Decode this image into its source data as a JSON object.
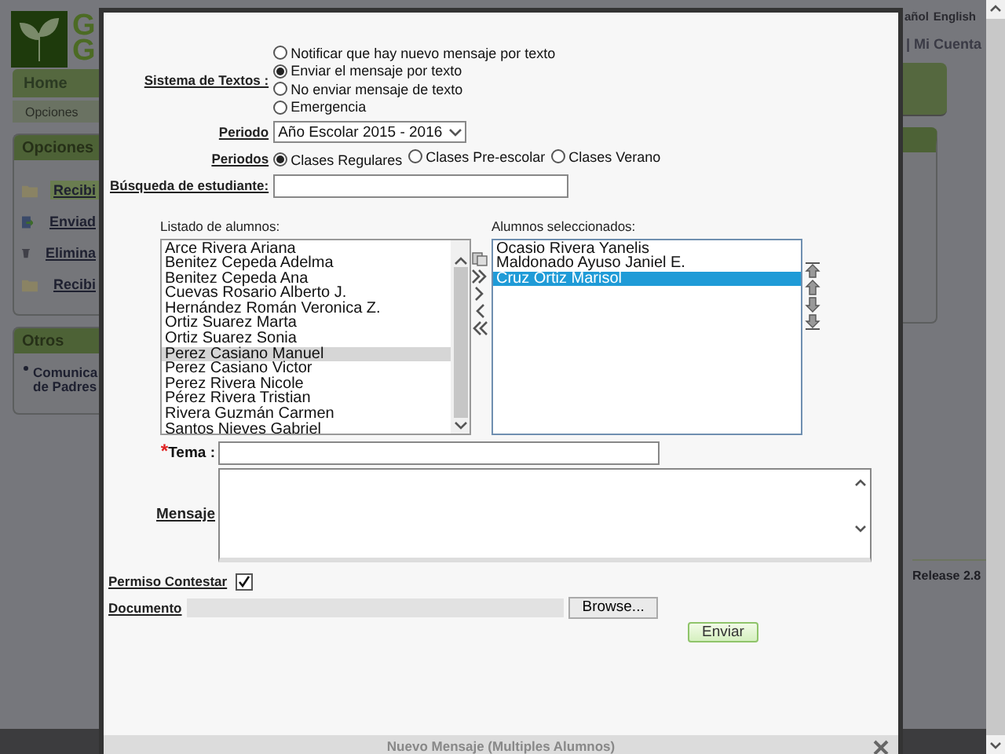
{
  "background_page": {
    "logo_letters": [
      "G",
      "G"
    ],
    "language_links": [
      "añol",
      "English"
    ],
    "account_link": "| Mi Cuenta",
    "nav_tab": "Home",
    "sub_nav": "Opciones",
    "options_panel": {
      "title": "Opciones",
      "items": [
        {
          "label": "Recibi",
          "kind": "folder",
          "selected": true
        },
        {
          "label": "Enviad",
          "kind": "send",
          "selected": false
        },
        {
          "label": "Elimina",
          "kind": "trash",
          "selected": false
        },
        {
          "label": "Recibi",
          "kind": "folder",
          "selected": false
        }
      ]
    },
    "others_panel": {
      "title": "Otros",
      "items": [
        {
          "lines": [
            "Comunica",
            "de Padres"
          ]
        }
      ]
    },
    "release": "Release 2.8"
  },
  "dialog": {
    "title": "Nuevo Mensaje (Multiples Alumnos)",
    "sms_system": {
      "label": "Sistema de Textos :",
      "options": [
        {
          "label": "Notificar que hay nuevo mensaje por texto",
          "selected": false
        },
        {
          "label": "Enviar el mensaje por texto",
          "selected": true
        },
        {
          "label": "No enviar mensaje de texto",
          "selected": false
        },
        {
          "label": "Emergencia",
          "selected": false
        }
      ]
    },
    "period": {
      "label": "Periodo",
      "value": "Año Escolar 2015 - 2016"
    },
    "periods": {
      "label": "Periodos",
      "options": [
        {
          "label": "Clases Regulares",
          "selected": true
        },
        {
          "label": "Clases Pre-escolar",
          "selected": false
        },
        {
          "label": "Clases Verano",
          "selected": false
        }
      ]
    },
    "search": {
      "label": "Búsqueda de estudiante:"
    },
    "available": {
      "label": "Listado de alumnos:",
      "focused": false,
      "items": [
        {
          "name": "Arce Rivera Ariana",
          "selected": false
        },
        {
          "name": "Benitez Cepeda Adelma",
          "selected": false
        },
        {
          "name": "Benitez Cepeda Ana",
          "selected": false
        },
        {
          "name": "Cuevas Rosario Alberto J.",
          "selected": false
        },
        {
          "name": "Hernández Román Veronica Z.",
          "selected": false
        },
        {
          "name": "Ortiz Suarez Marta",
          "selected": false
        },
        {
          "name": "Ortiz Suarez Sonia",
          "selected": false
        },
        {
          "name": "Perez Casiano Manuel",
          "selected": true
        },
        {
          "name": "Perez Casiano Victor",
          "selected": false
        },
        {
          "name": "Perez Rivera Nicole",
          "selected": false
        },
        {
          "name": "Pérez Rivera Tristian",
          "selected": false
        },
        {
          "name": "Rivera Guzmán Carmen",
          "selected": false
        },
        {
          "name": "Santos Nieves Gabriel",
          "selected": false
        }
      ]
    },
    "chosen": {
      "label": "Alumnos seleccionados:",
      "focused": true,
      "items": [
        {
          "name": "Ocasio Rivera Yanelis",
          "selected": false
        },
        {
          "name": "Maldonado Ayuso Janiel E.",
          "selected": false
        },
        {
          "name": "Cruz Ortiz Marisol",
          "selected": true
        }
      ]
    },
    "subject": {
      "label": "Tema :",
      "required_mark": "*"
    },
    "message": {
      "label": "Mensaje"
    },
    "allow_reply": {
      "label": "Permiso Contestar",
      "checked": true
    },
    "document": {
      "label": "Documento",
      "browse": "Browse..."
    },
    "send": "Enviar"
  }
}
